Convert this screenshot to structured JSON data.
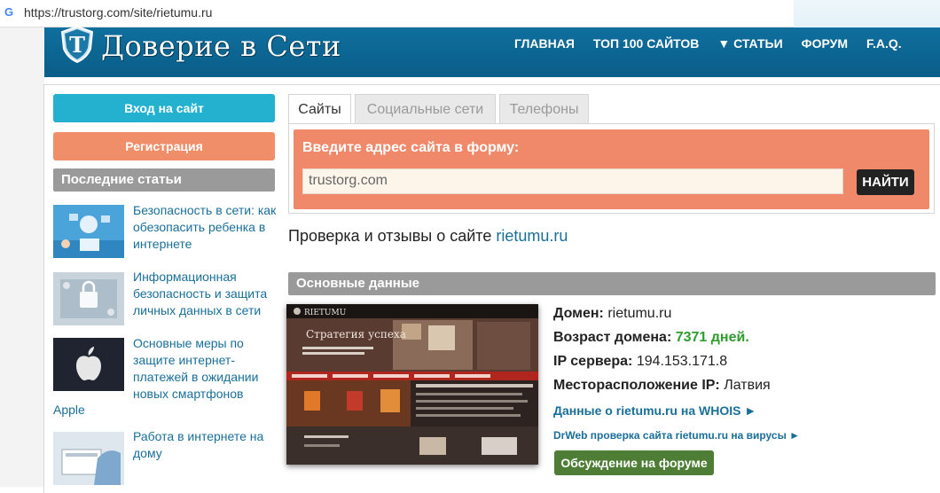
{
  "browser": {
    "url": "https://trustorg.com/site/rietumu.ru"
  },
  "header": {
    "logo_text": "Доверие в Сети",
    "logo_letter": "T",
    "nav": [
      "ГЛАВНАЯ",
      "ТОП 100 САЙТОВ",
      "▼ СТАТЬИ",
      "ФОРУМ",
      "F.A.Q."
    ]
  },
  "sidebar": {
    "login_label": "Вход на сайт",
    "register_label": "Регистрация",
    "recent_title": "Последние статьи",
    "articles": [
      {
        "title": "Безопасность в сети: как обезопасить ребенка в интернете"
      },
      {
        "title": "Информационная безопасность и защита личных данных в сети"
      },
      {
        "title": "Основные меры по защите интернет-платежей в ожидании новых смартфонов",
        "extra": "Apple"
      },
      {
        "title": "Работа в интернете на дому"
      }
    ]
  },
  "tabs": [
    "Сайты",
    "Социальные сети",
    "Телефоны"
  ],
  "search": {
    "label": "Введите адрес сайта в форму:",
    "value": "trustorg.com",
    "button": "НАЙТИ"
  },
  "check": {
    "prefix": "Проверка и отзывы о сайте",
    "domain": "rietumu.ru"
  },
  "main": {
    "section_title": "Основные данные",
    "domain_label": "Домен:",
    "domain_value": "rietumu.ru",
    "age_label": "Возраст домена:",
    "age_value": "7371 дней.",
    "ip_label": "IP сервера:",
    "ip_value": "194.153.171.8",
    "location_label": "Месторасположение IP:",
    "location_value": "Латвия",
    "whois_link": "Данные о rietumu.ru на WHOIS ►",
    "drweb_link": "DrWeb проверка сайта rietumu.ru на вирусы ►",
    "forum_button": "Обсуждение на форуме"
  },
  "thumb": {
    "brand": "RIETUMU",
    "slogan": "Стратегия успеха"
  },
  "colors": {
    "header": "#0f6f9e",
    "login": "#24b1cf",
    "register": "#f08e69",
    "link": "#1a6f98",
    "green": "#2e9d2e",
    "forum": "#4e7d35"
  }
}
